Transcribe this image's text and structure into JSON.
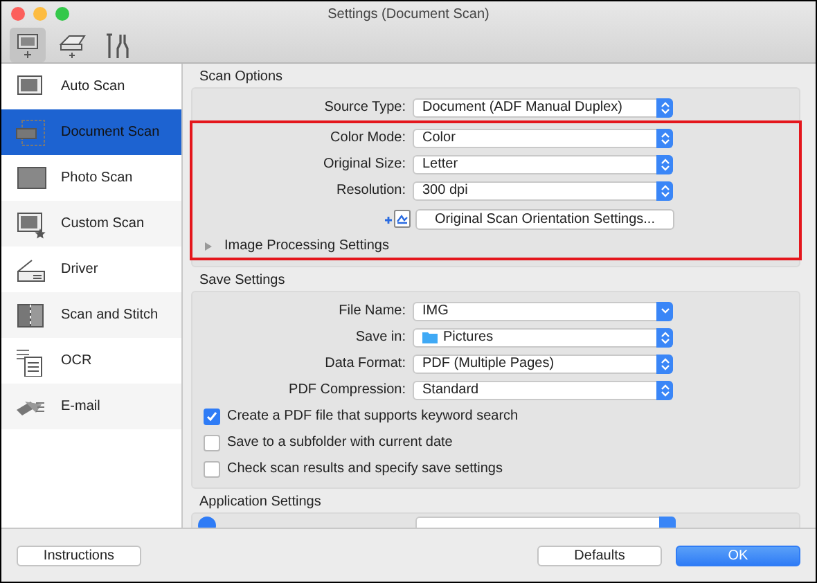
{
  "window": {
    "title": "Settings (Document Scan)"
  },
  "toolbar": [
    {
      "kind": "scanner",
      "selected": true
    },
    {
      "kind": "tray",
      "selected": false
    },
    {
      "kind": "tools",
      "selected": false
    }
  ],
  "sidebar": {
    "items": [
      {
        "label": "Auto Scan",
        "kind": "auto",
        "selected": false
      },
      {
        "label": "Document Scan",
        "kind": "document",
        "selected": true
      },
      {
        "label": "Photo Scan",
        "kind": "photo",
        "selected": false
      },
      {
        "label": "Custom Scan",
        "kind": "custom",
        "selected": false
      },
      {
        "label": "Driver",
        "kind": "driver",
        "selected": false
      },
      {
        "label": "Scan and Stitch",
        "kind": "stitch",
        "selected": false
      },
      {
        "label": "OCR",
        "kind": "ocr",
        "selected": false
      },
      {
        "label": "E-mail",
        "kind": "email",
        "selected": false
      }
    ]
  },
  "scan_options": {
    "title": "Scan Options",
    "fields": [
      {
        "label": "Source Type:",
        "value": "Document (ADF Manual Duplex)",
        "kind": "popup"
      }
    ],
    "highlight_box": {
      "fields": [
        {
          "label": "Color Mode:",
          "value": "Color",
          "kind": "popup"
        },
        {
          "label": "Original Size:",
          "value": "Letter",
          "kind": "popup"
        },
        {
          "label": "Resolution:",
          "value": "300 dpi",
          "kind": "popup"
        }
      ],
      "orientation_button": "Original Scan Orientation Settings...",
      "image_processing": {
        "label": "Image Processing Settings",
        "expanded": false
      }
    }
  },
  "save_settings": {
    "title": "Save Settings",
    "fields": [
      {
        "label": "File Name:",
        "value": "IMG",
        "kind": "combo"
      },
      {
        "label": "Save in:",
        "value": "Pictures",
        "kind": "folder"
      },
      {
        "label": "Data Format:",
        "value": "PDF (Multiple Pages)",
        "kind": "popup"
      },
      {
        "label": "PDF Compression:",
        "value": "Standard",
        "kind": "popup"
      }
    ],
    "checkboxes": [
      {
        "label": "Create a PDF file that supports keyword search",
        "checked": true
      },
      {
        "label": "Save to a subfolder with current date",
        "checked": false
      },
      {
        "label": "Check scan results and specify save settings",
        "checked": false
      }
    ]
  },
  "application_settings": {
    "title": "Application Settings",
    "open_with": {
      "selected": true
    }
  },
  "buttons": [
    {
      "label": "Instructions",
      "default": false
    },
    {
      "label": "Defaults",
      "default": false
    },
    {
      "label": "OK",
      "default": true
    }
  ]
}
